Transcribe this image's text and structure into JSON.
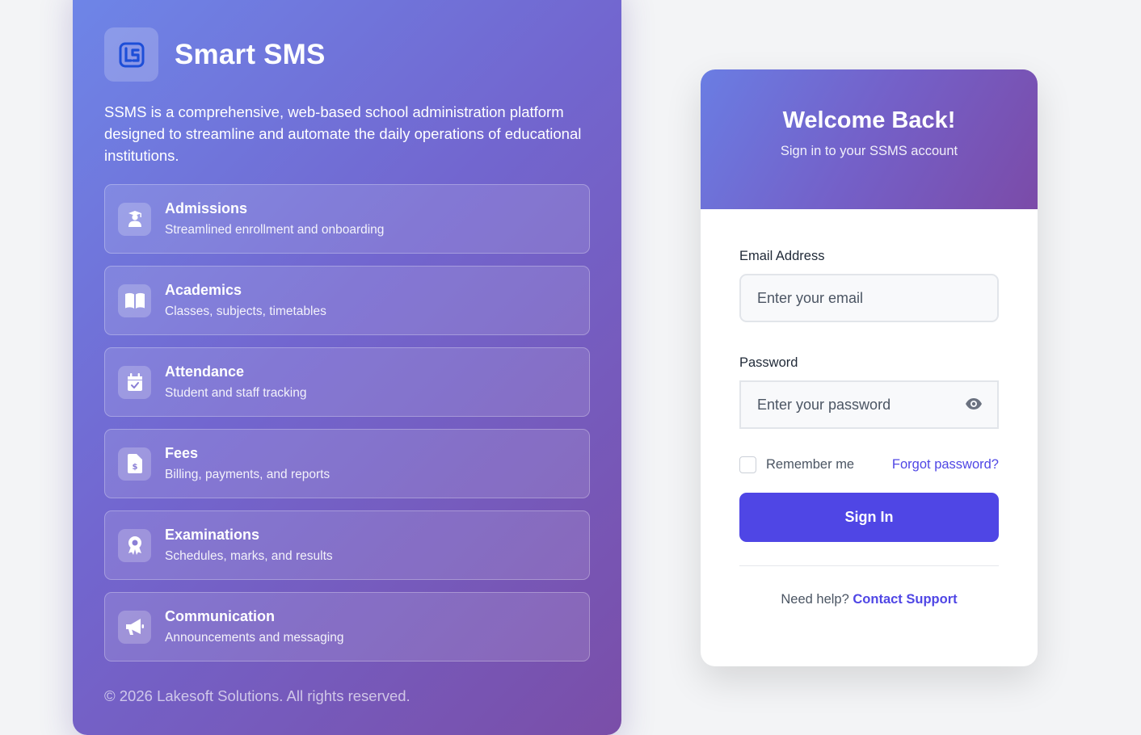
{
  "brand": {
    "logo_icon": "ssms-logo-icon",
    "name": "Smart SMS",
    "description": "SSMS is a comprehensive, web-based school administration platform designed to streamline and automate the daily operations of educational institutions."
  },
  "features": [
    {
      "icon": "graduate-icon",
      "title": "Admissions",
      "subtitle": "Streamlined enrollment and onboarding"
    },
    {
      "icon": "book-icon",
      "title": "Academics",
      "subtitle": "Classes, subjects, timetables"
    },
    {
      "icon": "calendar-check-icon",
      "title": "Attendance",
      "subtitle": "Student and staff tracking"
    },
    {
      "icon": "invoice-dollar-icon",
      "title": "Fees",
      "subtitle": "Billing, payments, and reports"
    },
    {
      "icon": "award-icon",
      "title": "Examinations",
      "subtitle": "Schedules, marks, and results"
    },
    {
      "icon": "megaphone-icon",
      "title": "Communication",
      "subtitle": "Announcements and messaging"
    }
  ],
  "copyright": "© 2026 Lakesoft Solutions. All rights reserved.",
  "login": {
    "title": "Welcome Back!",
    "subtitle": "Sign in to your SSMS account",
    "email_label": "Email Address",
    "email_placeholder": "Enter your email",
    "password_label": "Password",
    "password_placeholder": "Enter your password",
    "remember_label": "Remember me",
    "forgot_label": "Forgot password?",
    "signin_label": "Sign In",
    "help_text": "Need help?",
    "help_link": "Contact Support"
  },
  "colors": {
    "accent": "#4f46e5",
    "panel_gradient_start": "#6e86e8",
    "panel_gradient_end": "#7a4ea8"
  }
}
